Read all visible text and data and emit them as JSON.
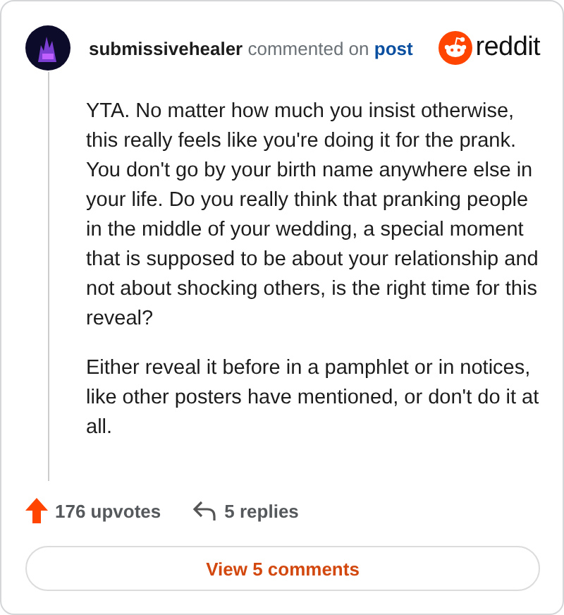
{
  "comment": {
    "author": "submissivehealer",
    "action": "commented on",
    "link": "post",
    "logo": "reddit",
    "paragraphs": [
      "YTA. No matter how much you insist otherwise, this really feels like you're doing it for the prank. You don't go by your birth name anywhere else in your life. Do you really think that pranking people in the middle of your wedding, a special moment that is supposed to be about your relationship and not about shocking others, is the right time for this reveal?",
      "Either reveal it before in a pamphlet or in notices, like other posters have mentioned, or don't do it at all."
    ],
    "upvotes": "176 upvotes",
    "replies": "5 replies",
    "button": "View 5 comments"
  }
}
